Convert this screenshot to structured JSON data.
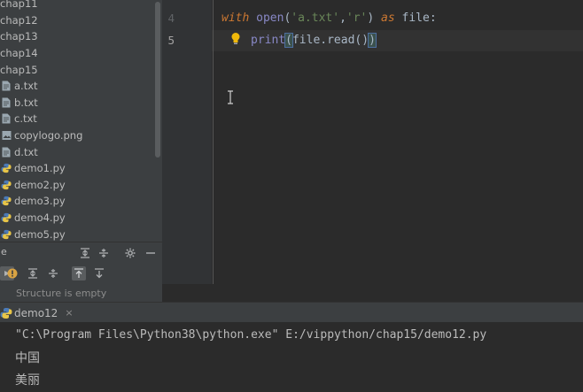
{
  "project_tree": {
    "items": [
      {
        "label": "chap11",
        "type": "folder"
      },
      {
        "label": "chap12",
        "type": "folder"
      },
      {
        "label": "chap13",
        "type": "folder"
      },
      {
        "label": "chap14",
        "type": "folder"
      },
      {
        "label": "chap15",
        "type": "folder"
      },
      {
        "label": "a.txt",
        "type": "text-file-icon"
      },
      {
        "label": "b.txt",
        "type": "text-file-icon"
      },
      {
        "label": "c.txt",
        "type": "text-file-icon"
      },
      {
        "label": "copylogo.png",
        "type": "image-file-icon"
      },
      {
        "label": "d.txt",
        "type": "text-file-icon"
      },
      {
        "label": "demo1.py",
        "type": "python-file-icon"
      },
      {
        "label": "demo2.py",
        "type": "python-file-icon"
      },
      {
        "label": "demo3.py",
        "type": "python-file-icon"
      },
      {
        "label": "demo4.py",
        "type": "python-file-icon"
      },
      {
        "label": "demo5.py",
        "type": "python-file-icon"
      }
    ]
  },
  "structure": {
    "header_letter": "e",
    "empty_text": "Structure is empty"
  },
  "editor": {
    "lines": [
      {
        "number": "4",
        "tokens": [
          {
            "t": "with",
            "c": "kw"
          },
          {
            "t": " ",
            "c": ""
          },
          {
            "t": "open",
            "c": "fn"
          },
          {
            "t": "(",
            "c": ""
          },
          {
            "t": "'a.txt'",
            "c": "str"
          },
          {
            "t": ",",
            "c": ""
          },
          {
            "t": "'r'",
            "c": "str"
          },
          {
            "t": ") ",
            "c": ""
          },
          {
            "t": "as",
            "c": "kw"
          },
          {
            "t": " file:",
            "c": ""
          }
        ]
      },
      {
        "number": "5",
        "tokens": [
          {
            "t": "print",
            "c": "fn"
          },
          {
            "t": "(",
            "c": "brace-hl"
          },
          {
            "t": "file.read()",
            "c": ""
          },
          {
            "t": ")",
            "c": "brace-hl"
          }
        ]
      }
    ]
  },
  "run_window": {
    "tab_label": "demo12",
    "close_glyph": "×",
    "console_lines": [
      "\"C:\\Program Files\\Python38\\python.exe\" E:/vippython/chap15/demo12.py",
      "中国",
      "美丽"
    ]
  },
  "colors": {
    "background": "#2b2b2b",
    "panel": "#3c3f41",
    "keyword": "#cc7832",
    "builtin": "#8888c6",
    "string": "#6a8759"
  }
}
